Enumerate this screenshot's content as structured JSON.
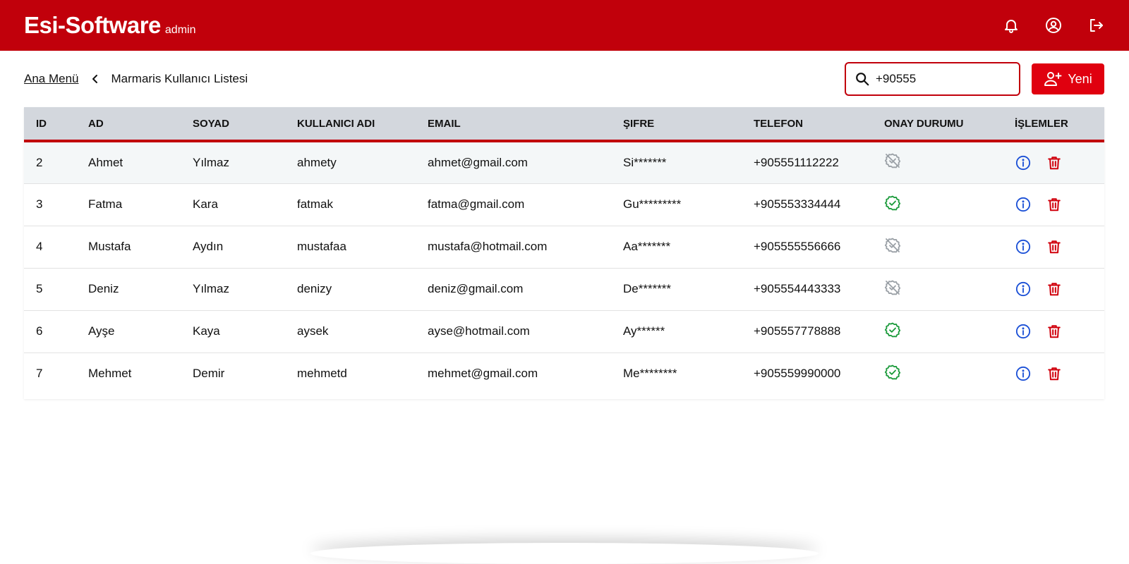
{
  "header": {
    "title": "Esi-Software",
    "role": "admin",
    "icons": [
      "bell-icon",
      "account-circle-icon",
      "logout-icon"
    ]
  },
  "breadcrumb": {
    "home": "Ana Menü",
    "current": "Marmaris Kullanıcı Listesi"
  },
  "search": {
    "value": "+90555"
  },
  "new_button": {
    "label": "Yeni"
  },
  "table": {
    "columns": [
      "ID",
      "AD",
      "SOYAD",
      "KULLANICI ADI",
      "EMAIL",
      "ŞIFRE",
      "TELEFON",
      "ONAY DURUMU",
      "İŞLEMLER"
    ],
    "rows": [
      {
        "id": "2",
        "ad": "Ahmet",
        "soyad": "Yılmaz",
        "kullanici": "ahmety",
        "email": "ahmet@gmail.com",
        "sifre": "Si*******",
        "telefon": "+905551112222",
        "onay": false
      },
      {
        "id": "3",
        "ad": "Fatma",
        "soyad": "Kara",
        "kullanici": "fatmak",
        "email": "fatma@gmail.com",
        "sifre": "Gu*********",
        "telefon": "+905553334444",
        "onay": true
      },
      {
        "id": "4",
        "ad": "Mustafa",
        "soyad": "Aydın",
        "kullanici": "mustafaa",
        "email": "mustafa@hotmail.com",
        "sifre": "Aa*******",
        "telefon": "+905555556666",
        "onay": false
      },
      {
        "id": "5",
        "ad": "Deniz",
        "soyad": "Yılmaz",
        "kullanici": "denizy",
        "email": "deniz@gmail.com",
        "sifre": "De*******",
        "telefon": "+905554443333",
        "onay": false
      },
      {
        "id": "6",
        "ad": "Ayşe",
        "soyad": "Kaya",
        "kullanici": "aysek",
        "email": "ayse@hotmail.com",
        "sifre": "Ay******",
        "telefon": "+905557778888",
        "onay": true
      },
      {
        "id": "7",
        "ad": "Mehmet",
        "soyad": "Demir",
        "kullanici": "mehmetd",
        "email": "mehmet@gmail.com",
        "sifre": "Me********",
        "telefon": "+905559990000",
        "onay": true
      }
    ]
  },
  "colors": {
    "brand": "#c1000b",
    "button": "#e0000f",
    "approved": "#1a9a3a",
    "unapproved": "#9aa0a6",
    "info": "#1a4fd6",
    "delete": "#d0000c"
  }
}
